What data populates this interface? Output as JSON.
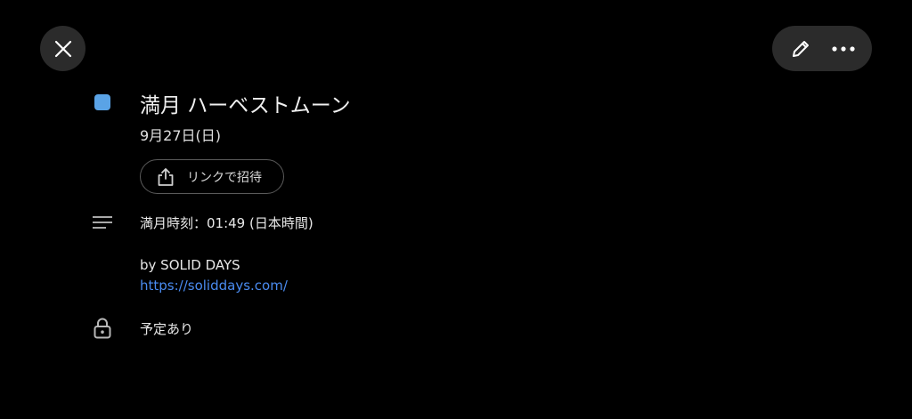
{
  "header": {
    "close_icon": "close-icon",
    "edit_icon": "pencil-icon",
    "more_icon": "more-horizontal-icon"
  },
  "event": {
    "color": "#5aa3e6",
    "title": "満月 ハーベストムーン",
    "date": "9月27日(日)",
    "invite_label": "リンクで招待",
    "description": {
      "time_line": "満月時刻：01:49 (日本時間)",
      "by_line": "by SOLID DAYS",
      "link": "https://soliddays.com/"
    },
    "availability": "予定あり"
  },
  "colors": {
    "background": "#000000",
    "button_bg": "#2b2b2b",
    "link": "#4a8bf0"
  }
}
